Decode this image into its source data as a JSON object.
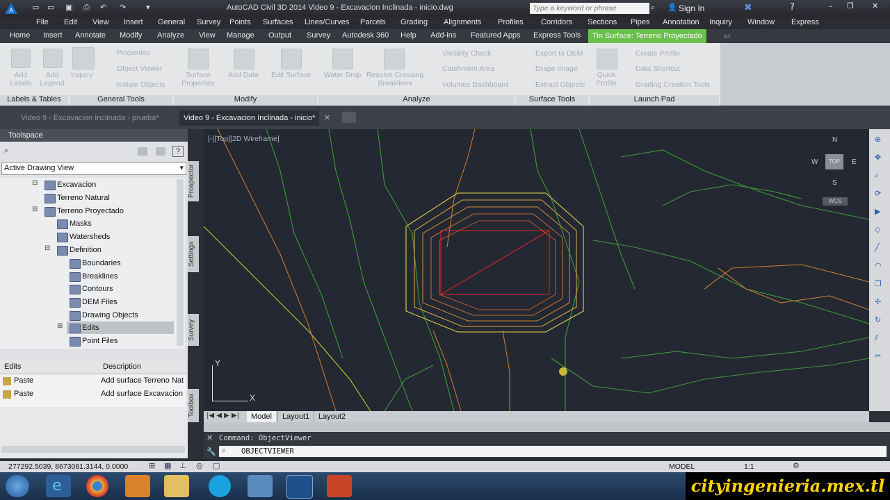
{
  "window": {
    "title": "AutoCAD Civil 3D 2014   Video 9 - Excavacion Inclinada - inicio.dwg",
    "search_placeholder": "Type a keyword or phrase",
    "sign_in": "Sign In"
  },
  "menu": [
    "File",
    "Edit",
    "View",
    "Insert",
    "General",
    "Survey",
    "Points",
    "Surfaces",
    "Lines/Curves",
    "Parcels",
    "Grading",
    "Alignments",
    "Profiles",
    "Corridors",
    "Sections",
    "Pipes",
    "Annotation",
    "Inquiry",
    "Window",
    "Express"
  ],
  "ribbon_tabs": [
    "Home",
    "Insert",
    "Annotate",
    "Modify",
    "Analyze",
    "View",
    "Manage",
    "Output",
    "Survey",
    "Autodesk 360",
    "Help",
    "Add-ins",
    "Featured Apps",
    "Express Tools",
    "Tin Surface: Terreno Proyectado"
  ],
  "ribbon": {
    "labels_tables": {
      "add_labels": "Add Labels",
      "add_legend": "Add Legend",
      "title": "Labels & Tables"
    },
    "general_tools": {
      "inquiry": "Inquiry",
      "properties": "Properties",
      "object_viewer": "Object Viewer",
      "isolate_objects": "Isolate Objects",
      "title": "General Tools"
    },
    "modify": {
      "surface_properties": "Surface Properties",
      "add_data": "Add Data",
      "edit_surface": "Edit Surface",
      "title": "Modify"
    },
    "analyze": {
      "water_drop": "Water Drop",
      "resolve_crossing_breaklines": "Resolve Crossing Breaklines",
      "visibility_check": "Visibility Check",
      "catchment_area": "Catchment Area",
      "volumes_dashboard": "Volumes Dashboard",
      "title": "Analyze"
    },
    "surface_tools": {
      "export_to_dem": "Export to DEM",
      "drape_image": "Drape Image",
      "extract_objects": "Extract Objects",
      "title": "Surface Tools"
    },
    "launch_pad": {
      "quick_profile": "Quick Profile",
      "create_profile": "Create Profile",
      "data_shortcut": "Data Shortcut",
      "grading_creation_tools": "Grading Creation Tools",
      "title": "Launch Pad"
    }
  },
  "doc_tabs": [
    "Video 9 - Excavacion Inclinada - prueba*",
    "Video 9 - Excavacion Inclinada - inicio*"
  ],
  "toolspace": {
    "title": "Toolspace",
    "view_select": "Active Drawing View",
    "tree": [
      "Excavacion",
      "Terreno Natural",
      "Terreno Proyectado",
      "Masks",
      "Watersheds",
      "Definition",
      "Boundaries",
      "Breaklines",
      "Contours",
      "DEM Files",
      "Drawing Objects",
      "Edits",
      "Point Files"
    ],
    "side_tabs": [
      "Prospector",
      "Settings",
      "Survey",
      "Toolbox"
    ],
    "edits_table": {
      "headers": [
        "Edits",
        "Description"
      ],
      "rows": [
        [
          "Paste",
          "Add surface Terreno Nat"
        ],
        [
          "Paste",
          "Add surface Excavacion"
        ]
      ]
    }
  },
  "viewport": {
    "label": "[-][Top][2D Wireframe]",
    "compass": {
      "n": "N",
      "s": "S",
      "e": "E",
      "w": "W",
      "top": "TOP",
      "wcs": "WCS"
    },
    "ucs_x": "X",
    "ucs_y": "Y"
  },
  "layout_tabs": [
    "Model",
    "Layout1",
    "Layout2"
  ],
  "command": {
    "history": "Command: ObjectViewer",
    "current": "OBJECTVIEWER"
  },
  "status": {
    "coords": "277292.5039, 8673061.3144, 0.0000",
    "model": "MODEL",
    "scale": "1:1"
  },
  "watermark": "cityingenieria.mex.tl"
}
